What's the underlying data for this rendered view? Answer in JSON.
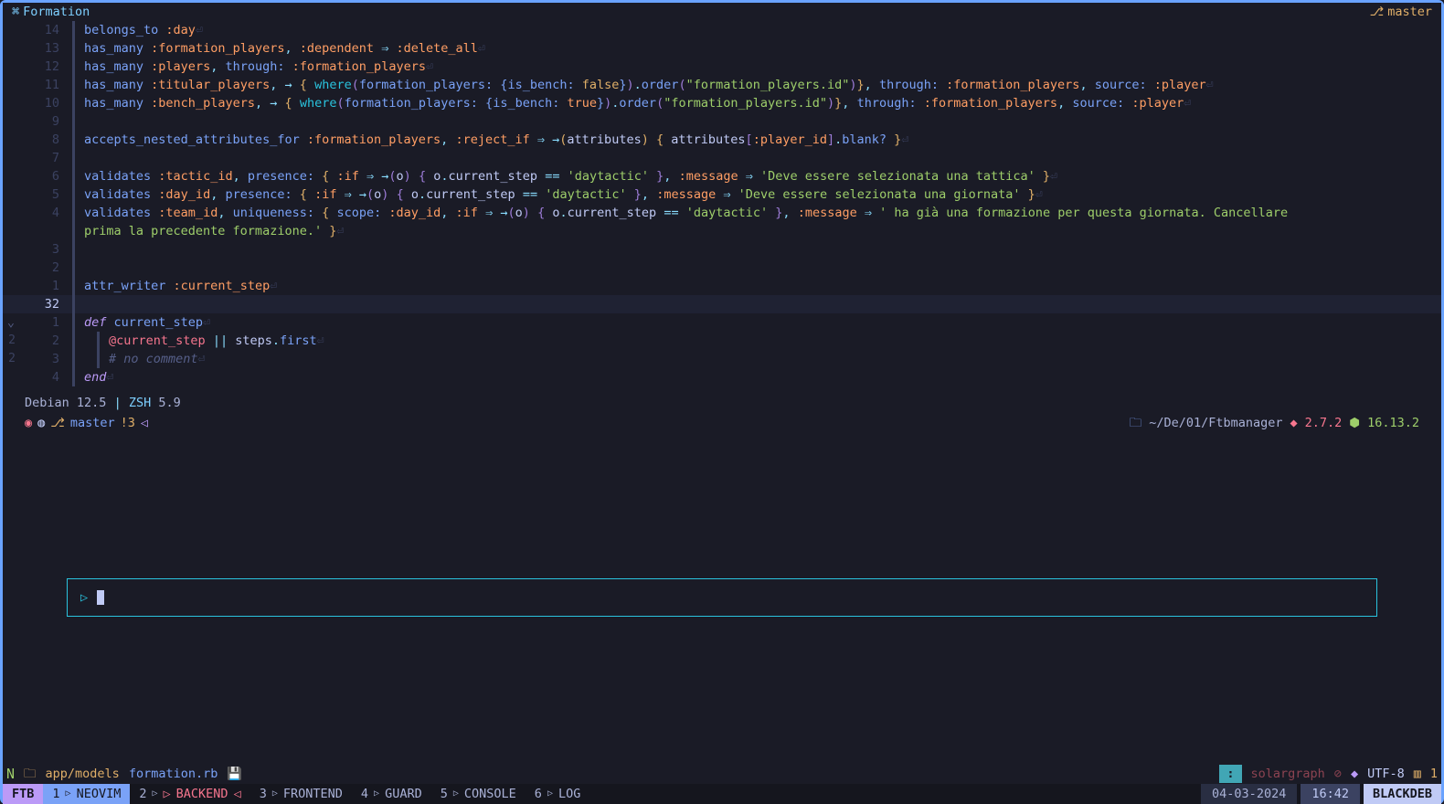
{
  "header": {
    "class_name": "Formation",
    "branch": "master"
  },
  "gutters": [
    "14",
    "13",
    "12",
    "11",
    "10",
    "9",
    "8",
    "7",
    "6",
    "5",
    "4",
    "",
    "3",
    "2",
    "1",
    "32",
    "1",
    "2",
    "3",
    "4"
  ],
  "sideMarks": {
    "chev": "⌄",
    "two": "2"
  },
  "code": {
    "l1": {
      "a": "belongs_to",
      "b": ":day"
    },
    "l2": {
      "a": "has_many",
      "b": ":formation_players",
      "c": ":dependent",
      "d": ":delete_all"
    },
    "l3": {
      "a": "has_many",
      "b": ":players",
      "c": "through:",
      "d": ":formation_players"
    },
    "l4": {
      "a": "has_many",
      "b": ":titular_players",
      "w": "where",
      "fp": "formation_players:",
      "ib": "is_bench:",
      "val": "false",
      "ord": "order",
      "s": "\"formation_players.id\"",
      "thr": "through:",
      "tp": ":formation_players",
      "src": "source:",
      "pl": ":player"
    },
    "l5": {
      "a": "has_many",
      "b": ":bench_players",
      "w": "where",
      "fp": "formation_players:",
      "ib": "is_bench:",
      "val": "true",
      "ord": "order",
      "s": "\"formation_players.id\"",
      "thr": "through:",
      "tp": ":formation_players",
      "src": "source:",
      "pl": ":player"
    },
    "l6": {
      "a": "accepts_nested_attributes_for",
      "b": ":formation_players",
      "c": ":reject_if",
      "att": "attributes",
      "pid": ":player_id",
      "blk": "blank?"
    },
    "l7": {
      "a": "validates",
      "b": ":tactic_id",
      "pre": "presence:",
      "if": ":if",
      "o": "o",
      "cs": "current_step",
      "dt": "'daytactic'",
      "msg": ":message",
      "txt": "'Deve essere selezionata una tattica'"
    },
    "l8": {
      "a": "validates",
      "b": ":day_id",
      "pre": "presence:",
      "if": ":if",
      "o": "o",
      "cs": "current_step",
      "dt": "'daytactic'",
      "msg": ":message",
      "txt": "'Deve essere selezionata una giornata'"
    },
    "l9": {
      "a": "validates",
      "b": ":team_id",
      "unq": "uniqueness:",
      "sc": "scope:",
      "di": ":day_id",
      "if": ":if",
      "o": "o",
      "cs": "current_step",
      "dt": "'daytactic'",
      "msg": ":message",
      "txt": "' ha già una formazione per questa giornata. Cancellare"
    },
    "l9b": "prima la precedente formazione.'",
    "l10": {
      "a": "attr_writer",
      "b": ":current_step"
    },
    "l11": {
      "a": "def",
      "b": "current_step"
    },
    "l12": {
      "iv": "@current_step",
      "or": "||",
      "st": "steps",
      "fr": "first"
    },
    "l13": "# no comment",
    "l14": "end"
  },
  "terminal": {
    "os": "Debian",
    "osv": "12.5",
    "sh": "ZSH",
    "shv": "5.9",
    "branch": "master",
    "dirty": "!3",
    "path": "~/De/01/Ftbmanager",
    "ruby": "2.7.2",
    "node": "16.13.2"
  },
  "status1": {
    "dir": "app/models",
    "file": "formation.rb",
    "lsp": "solargraph",
    "enc": "UTF-8",
    "pct": "1"
  },
  "status2": {
    "session": "FTB",
    "tabs": [
      {
        "n": "1",
        "label": "NEOVIM",
        "active": true
      },
      {
        "n": "2",
        "label": "BACKEND",
        "active": false,
        "red": true
      },
      {
        "n": "3",
        "label": "FRONTEND",
        "active": false
      },
      {
        "n": "4",
        "label": "GUARD",
        "active": false
      },
      {
        "n": "5",
        "label": "CONSOLE",
        "active": false
      },
      {
        "n": "6",
        "label": "LOG",
        "active": false
      }
    ],
    "date": "04-03-2024",
    "time": "16:42",
    "host": "BLACKDEB"
  }
}
